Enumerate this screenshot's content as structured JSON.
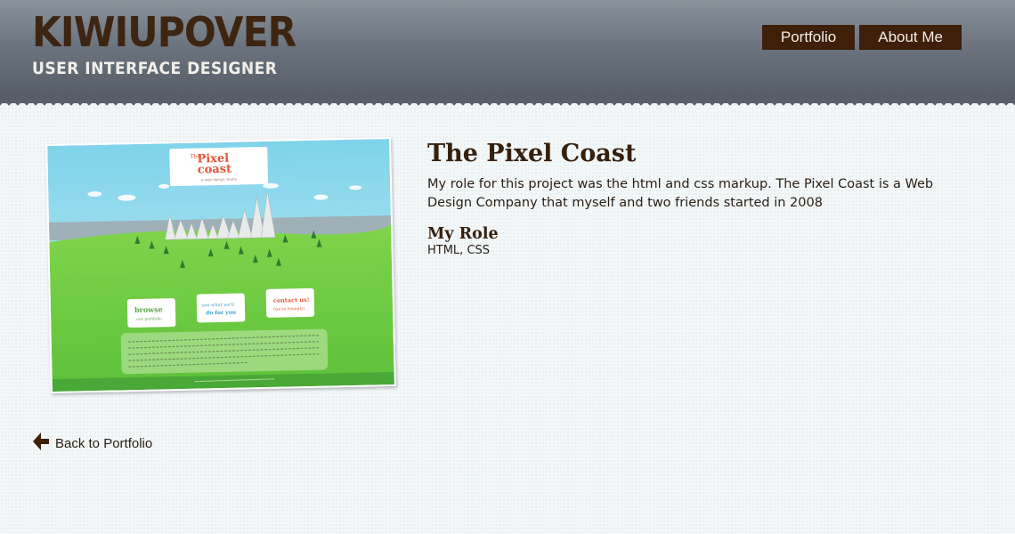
{
  "header": {
    "logo_title": "KIWIUPOVER",
    "logo_subtitle": "USER INTERFACE DESIGNER",
    "nav": [
      {
        "label": "Portfolio"
      },
      {
        "label": "About Me"
      }
    ]
  },
  "project": {
    "screenshot_text": {
      "brand_small": "The",
      "brand_line1": "Pixel",
      "brand_line2": "coast",
      "tagline": "a web design studio",
      "card1_line1": "browse",
      "card1_line2": "our portfolio",
      "card2_line1": "see what we'll",
      "card2_line2": "do for you",
      "card3_line1": "contact us!",
      "card3_line2": "(we're friendly)"
    },
    "title": "The Pixel Coast",
    "description": "My role for this project was the html and css markup. The Pixel Coast is a Web Design Company that myself and two friends started in 2008",
    "role_heading": "My Role",
    "role_value": "HTML, CSS"
  },
  "back_link": {
    "label": "Back to Portfolio",
    "icon": "arrow-left-icon"
  },
  "colors": {
    "header": "#6b737e",
    "logo": "#3d2511",
    "nav_bg": "#3d1f0a",
    "heading": "#36200e",
    "page_bg": "#f3f7f8"
  }
}
